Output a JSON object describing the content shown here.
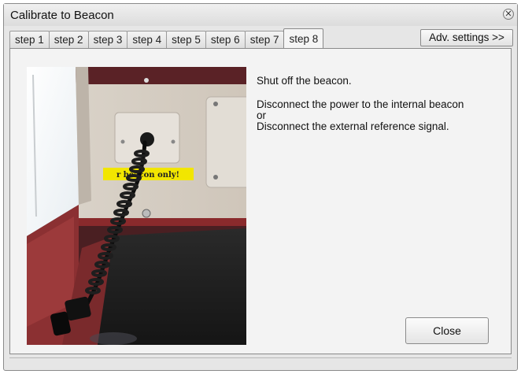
{
  "window": {
    "title": "Calibrate to Beacon",
    "close_glyph": "✕"
  },
  "tabs": [
    {
      "label": "step 1",
      "active": false
    },
    {
      "label": "step 2",
      "active": false
    },
    {
      "label": "step 3",
      "active": false
    },
    {
      "label": "step 4",
      "active": false
    },
    {
      "label": "step 5",
      "active": false
    },
    {
      "label": "step 6",
      "active": false
    },
    {
      "label": "step 7",
      "active": false
    },
    {
      "label": "step 8",
      "active": true
    }
  ],
  "adv_settings_label": "Adv. settings >>",
  "instructions": {
    "line1": "Shut off the beacon.",
    "line2": "Disconnect the power to the internal beacon",
    "line3": "or",
    "line4": "Disconnect the external reference signal."
  },
  "photo": {
    "sticker_text": "r beacon only!"
  },
  "close_label": "Close"
}
